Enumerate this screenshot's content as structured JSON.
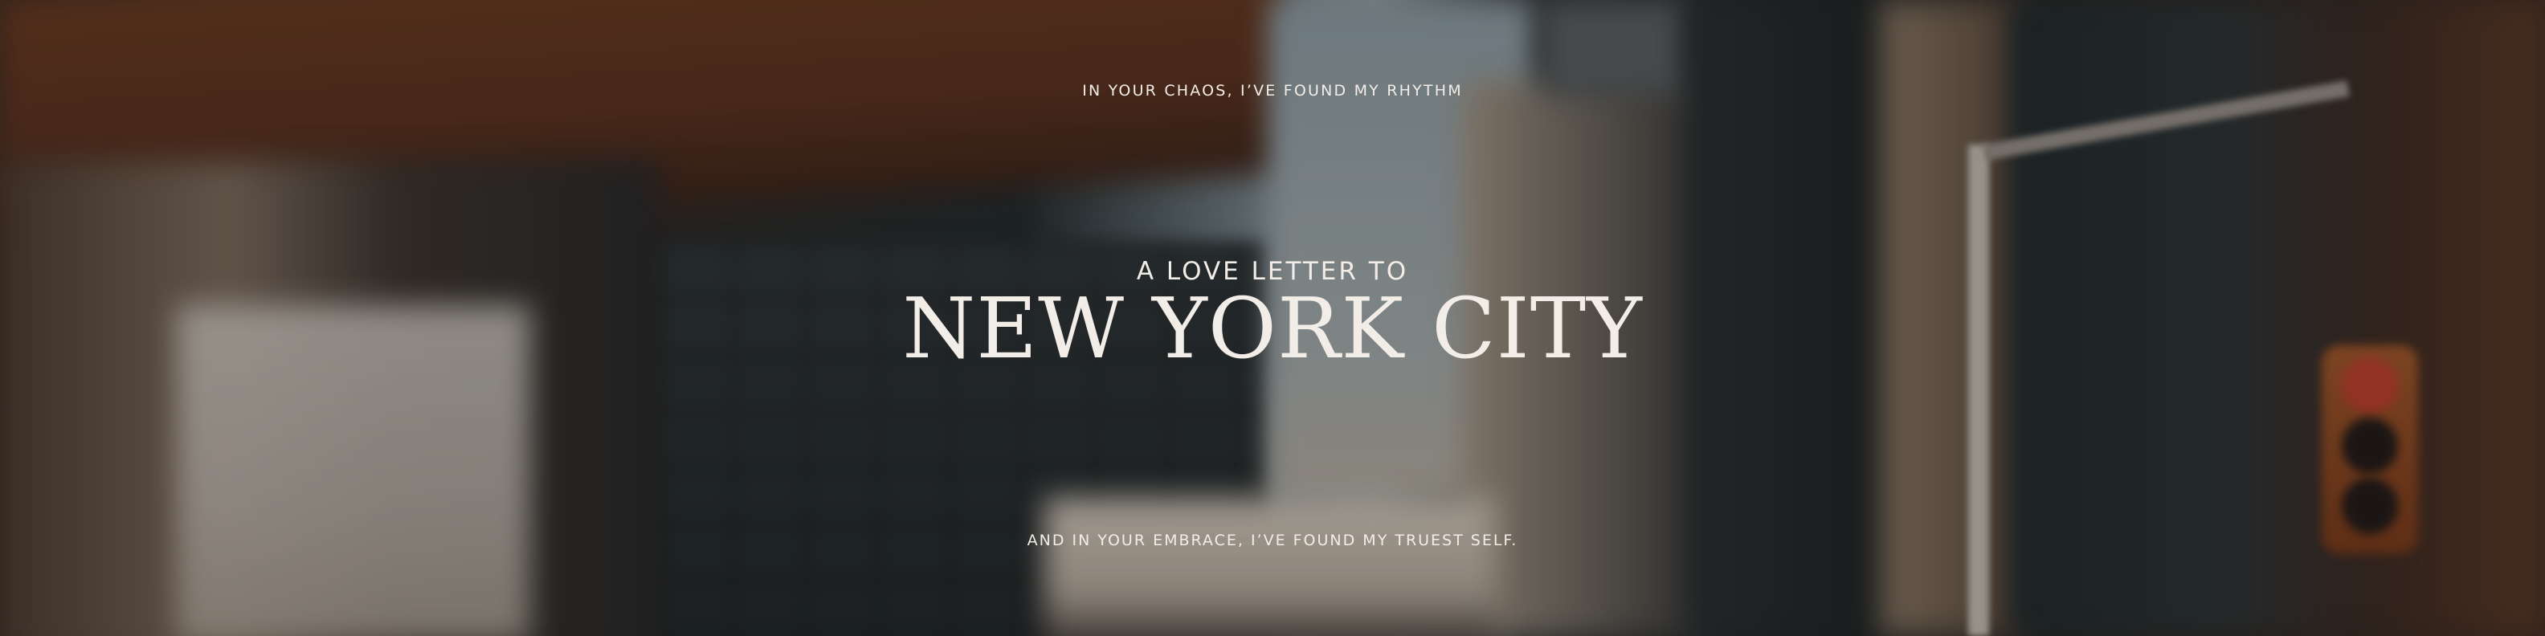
{
  "banner": {
    "tagline_top": "IN YOUR CHAOS, I’VE FOUND MY RHYTHM",
    "subtitle": "A LOVE LETTER TO",
    "title": "NEW YORK CITY",
    "tagline_bottom": "AND IN YOUR EMBRACE, I’VE FOUND MY TRUEST SELF."
  },
  "colors": {
    "text": "#f2ede6",
    "overlay": "rgba(20, 15, 12, 0.28)"
  }
}
